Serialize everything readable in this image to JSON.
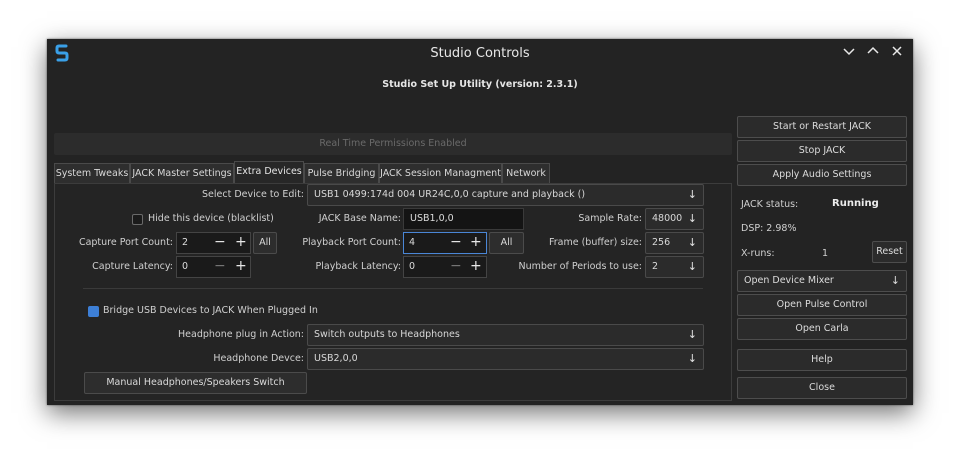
{
  "window": {
    "title": "Studio Controls",
    "subtitle": "Studio Set Up Utility (version: 2.3.1)"
  },
  "rt_status": "Real Time Permissions Enabled",
  "tabs": [
    "System Tweaks",
    "JACK Master Settings",
    "Extra Devices",
    "Pulse Bridging",
    "JACK Session Managment",
    "Network"
  ],
  "active_tab": "Extra Devices",
  "device": {
    "select_label": "Select Device to Edit:",
    "select_value": "USB1 0499:174d 004 UR24C,0,0 capture  and playback ()",
    "hide_label": "Hide this device (blacklist)",
    "hide_checked": false,
    "jack_base_label": "JACK Base Name:",
    "jack_base_value": "USB1,0,0",
    "sample_rate_label": "Sample Rate:",
    "sample_rate_value": "48000",
    "capture_count_label": "Capture Port Count:",
    "capture_count_value": "2",
    "playback_count_label": "Playback Port Count:",
    "playback_count_value": "4",
    "frame_label": "Frame (buffer) size:",
    "frame_value": "256",
    "capture_latency_label": "Capture Latency:",
    "capture_latency_value": "0",
    "playback_latency_label": "Playback Latency:",
    "playback_latency_value": "0",
    "periods_label": "Number of Periods to use:",
    "periods_value": "2",
    "all_label": "All"
  },
  "bridge": {
    "label": "Bridge USB Devices to JACK When Plugged In",
    "checked": true,
    "hp_action_label": "Headphone plug in Action:",
    "hp_action_value": "Switch outputs to Headphones",
    "hp_device_label": "Headphone Devce:",
    "hp_device_value": "USB2,0,0",
    "manual_switch_label": "Manual Headphones/Speakers Switch"
  },
  "right": {
    "start_restart": "Start or Restart  JACK",
    "stop": "Stop JACK",
    "apply": "Apply Audio Settings",
    "jack_status_label": "JACK status:",
    "jack_status_value": "Running",
    "dsp_label": "DSP: 2.98%",
    "xruns_label": "X-runs:",
    "xruns_value": "1",
    "reset": "Reset",
    "open_mixer": "Open Device Mixer",
    "open_pulse": "Open Pulse Control",
    "open_carla": "Open Carla",
    "help": "Help",
    "close": "Close"
  },
  "icons": {
    "logo": "studio-controls-logo",
    "minimize": "chevron-down-icon",
    "maximize": "chevron-up-icon",
    "close": "close-icon",
    "dropdown": "arrow-down-icon",
    "plus": "plus-icon",
    "minus": "minus-icon"
  },
  "colors": {
    "window_bg": "#232323",
    "accent": "#3d7fd6",
    "logo": "#3aa0e8"
  }
}
